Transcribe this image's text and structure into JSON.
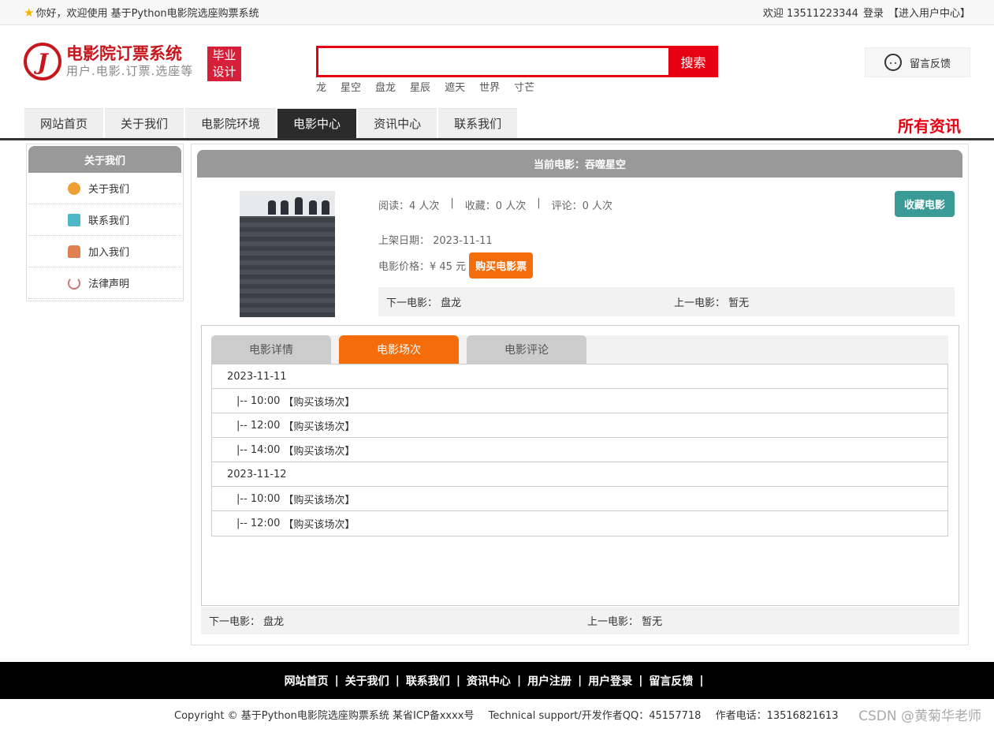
{
  "topbar": {
    "greeting": "你好，欢迎使用 基于Python电影院选座购票系统",
    "welcome": "欢迎 13511223344",
    "login": "登录",
    "user_center": "【进入用户中心】"
  },
  "header": {
    "logo_mark": "J",
    "logo_title": "电影院订票系统",
    "logo_sub": "用户.电影.订票.选座等",
    "badge_line1": "毕业",
    "badge_line2": "设计",
    "search_button": "搜索",
    "search_value": "",
    "hot_words": [
      "龙",
      "星空",
      "盘龙",
      "星辰",
      "遮天",
      "世界",
      "寸芒"
    ],
    "feedback": "留言反馈"
  },
  "nav": {
    "items": [
      "网站首页",
      "关于我们",
      "电影院环境",
      "电影中心",
      "资讯中心",
      "联系我们"
    ],
    "active_index": 3,
    "all_news": "所有资讯"
  },
  "sidebar": {
    "title": "关于我们",
    "items": [
      {
        "label": "关于我们",
        "icon": "about-icon"
      },
      {
        "label": "联系我们",
        "icon": "clipboard-icon"
      },
      {
        "label": "加入我们",
        "icon": "lock-icon"
      },
      {
        "label": "法律声明",
        "icon": "power-icon"
      }
    ]
  },
  "movie": {
    "header": "当前电影：吞噬星空",
    "read_label": "阅读：4 人次",
    "sep": "|",
    "fav_label": "收藏：0 人次",
    "comment_label": "评论：0 人次",
    "fav_button": "收藏电影",
    "date_line": "上架日期：  2023-11-11",
    "price_line": "电影价格：¥ 45 元",
    "buy_button": "购买电影票",
    "next_label": "下一电影：  盘龙",
    "prev_label": "上一电影：  暂无"
  },
  "tabs": {
    "items": [
      "电影详情",
      "电影场次",
      "电影评论"
    ],
    "active_index": 1
  },
  "sessions": [
    {
      "type": "date",
      "text": "2023-11-11"
    },
    {
      "type": "time",
      "text": "|-- 10:00",
      "link": "【购买该场次】"
    },
    {
      "type": "time",
      "text": "|-- 12:00",
      "link": "【购买该场次】"
    },
    {
      "type": "time",
      "text": "|-- 14:00",
      "link": "【购买该场次】"
    },
    {
      "type": "date",
      "text": "2023-11-12"
    },
    {
      "type": "time",
      "text": "|-- 10:00",
      "link": "【购买该场次】"
    },
    {
      "type": "time",
      "text": "|-- 12:00",
      "link": "【购买该场次】"
    }
  ],
  "bottom_nav": {
    "next_label": "下一电影：  盘龙",
    "prev_label": "上一电影：  暂无"
  },
  "footer": {
    "links": [
      "网站首页",
      "关于我们",
      "联系我们",
      "资讯中心",
      "用户注册",
      "用户登录",
      "留言反馈"
    ],
    "copyright": "Copyright © 基于Python电影院选座购票系统 某省ICP备xxxx号",
    "support": "Technical support/开发作者QQ：45157718",
    "phone": "作者电话：13516821613",
    "watermark": "CSDN @黄菊华老师"
  },
  "colors": {
    "brand_red": "#e60012",
    "accent_orange": "#f56c0a",
    "teal": "#3a9a95"
  }
}
